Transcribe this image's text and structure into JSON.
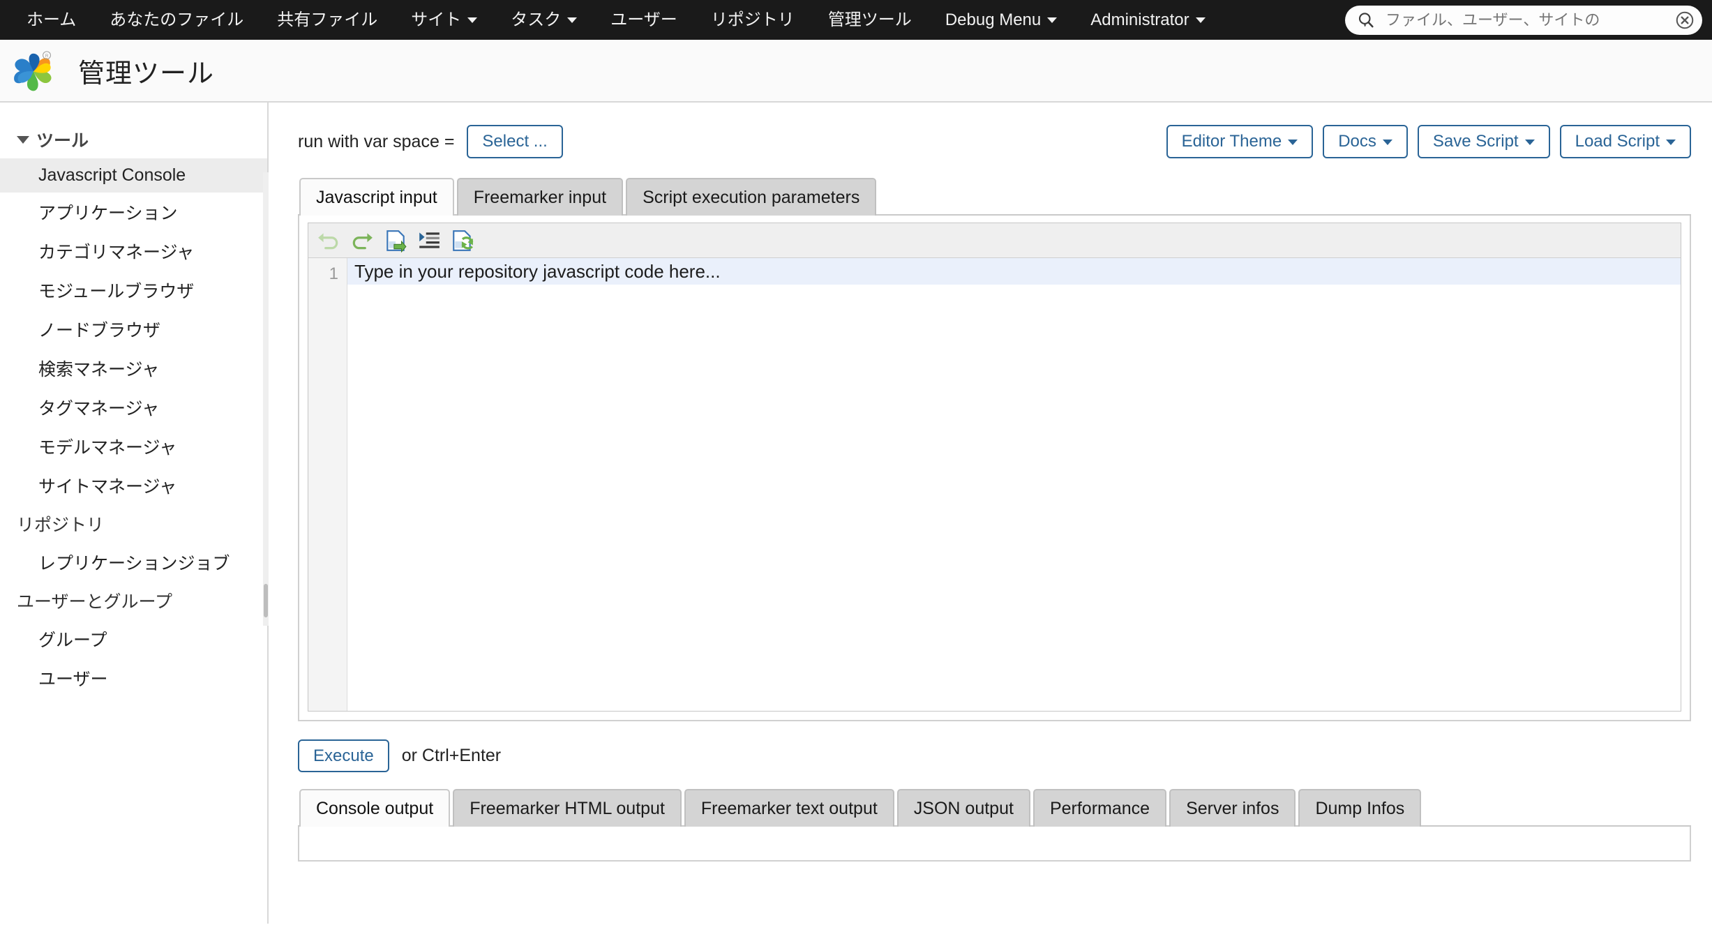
{
  "topnav": {
    "items": [
      {
        "label": "ホーム",
        "has_caret": false
      },
      {
        "label": "あなたのファイル",
        "has_caret": false
      },
      {
        "label": "共有ファイル",
        "has_caret": false
      },
      {
        "label": "サイト",
        "has_caret": true
      },
      {
        "label": "タスク",
        "has_caret": true
      },
      {
        "label": "ユーザー",
        "has_caret": false
      },
      {
        "label": "リポジトリ",
        "has_caret": false
      },
      {
        "label": "管理ツール",
        "has_caret": false
      },
      {
        "label": "Debug Menu",
        "has_caret": true
      },
      {
        "label": "Administrator",
        "has_caret": true
      }
    ],
    "search": {
      "placeholder": "ファイル、ユーザー、サイトの",
      "value": "",
      "search_icon": "search-icon",
      "clear_icon": "clear-circle-icon"
    }
  },
  "header": {
    "logo_icon": "alfresco-pinwheel-logo",
    "title": "管理ツール"
  },
  "sidebar": {
    "groups": [
      {
        "label": "ツール",
        "expanded": true,
        "has_triangle": true,
        "items": [
          {
            "label": "Javascript Console",
            "active": true
          },
          {
            "label": "アプリケーション",
            "active": false
          },
          {
            "label": "カテゴリマネージャ",
            "active": false
          },
          {
            "label": "モジュールブラウザ",
            "active": false
          },
          {
            "label": "ノードブラウザ",
            "active": false
          },
          {
            "label": "検索マネージャ",
            "active": false
          },
          {
            "label": "タグマネージャ",
            "active": false
          },
          {
            "label": "モデルマネージャ",
            "active": false
          },
          {
            "label": "サイトマネージャ",
            "active": false
          }
        ]
      },
      {
        "label": "リポジトリ",
        "expanded": true,
        "has_triangle": false,
        "items": [
          {
            "label": "レプリケーションジョブ",
            "active": false
          }
        ]
      },
      {
        "label": "ユーザーとグループ",
        "expanded": true,
        "has_triangle": false,
        "items": [
          {
            "label": "グループ",
            "active": false
          },
          {
            "label": "ユーザー",
            "active": false
          }
        ]
      }
    ]
  },
  "main": {
    "varspace": {
      "label": "run with var space =",
      "select_button": "Select ..."
    },
    "actions": [
      {
        "label": "Editor Theme",
        "caret": true
      },
      {
        "label": "Docs",
        "caret": true
      },
      {
        "label": "Save Script",
        "caret": true
      },
      {
        "label": "Load Script",
        "caret": true
      }
    ],
    "input_tabs": [
      {
        "label": "Javascript input",
        "active": true
      },
      {
        "label": "Freemarker input",
        "active": false
      },
      {
        "label": "Script execution parameters",
        "active": false
      }
    ],
    "editor": {
      "toolbar_icons": [
        "undo-icon",
        "redo-icon",
        "insert-document-icon",
        "indent-icon",
        "replace-document-icon"
      ],
      "line_number": "1",
      "placeholder": "Type in your repository javascript code here..."
    },
    "execute": {
      "button_label": "Execute",
      "hint": "or Ctrl+Enter"
    },
    "output_tabs": [
      {
        "label": "Console output",
        "active": true
      },
      {
        "label": "Freemarker HTML output",
        "active": false
      },
      {
        "label": "Freemarker text output",
        "active": false
      },
      {
        "label": "JSON output",
        "active": false
      },
      {
        "label": "Performance",
        "active": false
      },
      {
        "label": "Server infos",
        "active": false
      },
      {
        "label": "Dump Infos",
        "active": false
      }
    ],
    "output_content": ""
  },
  "colors": {
    "topnav_bg": "#1a1a1a",
    "accent_blue": "#2a6496",
    "tab_inactive": "#d4d4d4",
    "sidebar_active": "#ececec",
    "code_line_highlight": "#eaf0fb"
  }
}
